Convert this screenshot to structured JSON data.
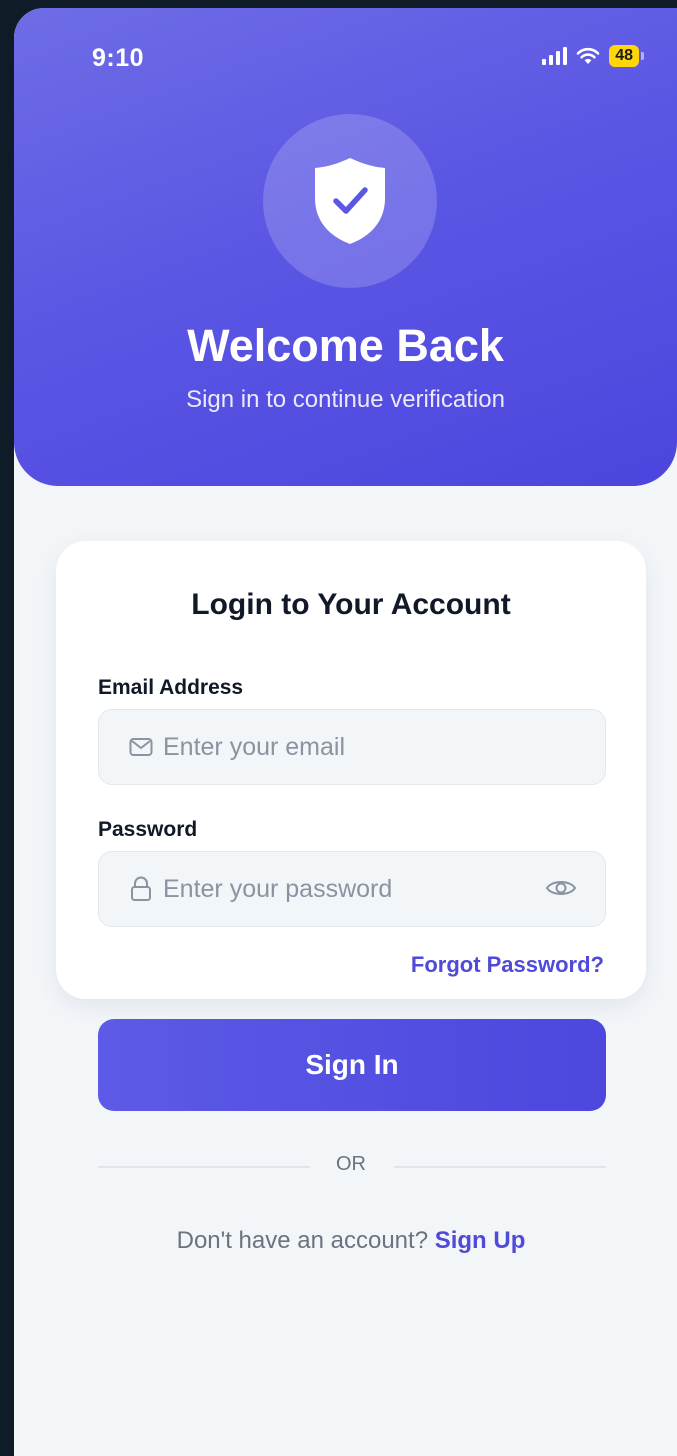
{
  "status_bar": {
    "time": "9:10",
    "battery": "48",
    "icons": [
      "signal-icon",
      "wifi-icon",
      "battery-icon"
    ]
  },
  "hero": {
    "icon": "shield-check-icon",
    "title": "Welcome Back",
    "subtitle": "Sign in to continue verification"
  },
  "login_card": {
    "title": "Login to Your Account",
    "email": {
      "label": "Email Address",
      "placeholder": "Enter your email",
      "value": "",
      "icon": "mail-icon"
    },
    "password": {
      "label": "Password",
      "placeholder": "Enter your password",
      "value": "",
      "icon": "lock-icon",
      "toggle_icon": "eye-icon"
    },
    "forgot_label": "Forgot Password?",
    "signin_label": "Sign In",
    "divider_label": "OR",
    "signup_prompt": "Don't have an account?",
    "signup_label": "Sign Up"
  },
  "colors": {
    "accent": "#5b57e4",
    "link": "#4f4ad8",
    "battery": "#ffd60a",
    "background": "#f3f6f9"
  }
}
